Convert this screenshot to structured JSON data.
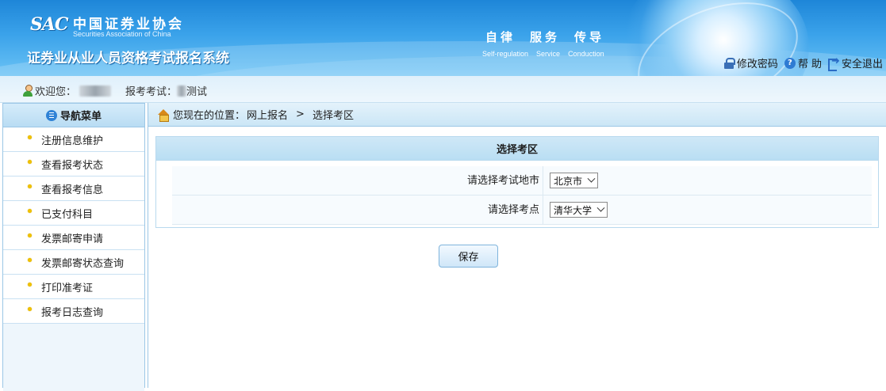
{
  "header": {
    "logo_text": "SAC",
    "org_name_cn": "中国证券业协会",
    "org_name_en": "Securities Association of China",
    "system_title": "证券业从业人员资格考试报名系统",
    "slogan_cn": [
      "自律",
      "服务",
      "传导"
    ],
    "slogan_en": [
      "Self-regulation",
      "Service",
      "Conduction"
    ],
    "links": {
      "change_password": "修改密码",
      "help": "帮 助",
      "logout": "安全退出"
    }
  },
  "welcome": {
    "greeting_label": "欢迎您：",
    "exam_label": "报考考试：",
    "exam_suffix": "测试"
  },
  "sidebar": {
    "title": "导航菜单",
    "items": [
      {
        "label": "注册信息维护"
      },
      {
        "label": "查看报考状态"
      },
      {
        "label": "查看报考信息"
      },
      {
        "label": "已支付科目"
      },
      {
        "label": "发票邮寄申请"
      },
      {
        "label": "发票邮寄状态查询"
      },
      {
        "label": "打印准考证"
      },
      {
        "label": "报考日志查询"
      }
    ]
  },
  "breadcrumb": {
    "prefix": "您现在的位置：",
    "level1": "网上报名",
    "separator": ">",
    "level2": "选择考区"
  },
  "form": {
    "title": "选择考区",
    "city_label": "请选择考试地市",
    "city_value": "北京市",
    "site_label": "请选择考点",
    "site_value": "清华大学",
    "save_label": "保存"
  },
  "colors": {
    "header_blue": "#1e86d8",
    "border_blue": "#9cc7e6",
    "bullet_yellow": "#f0c100"
  }
}
